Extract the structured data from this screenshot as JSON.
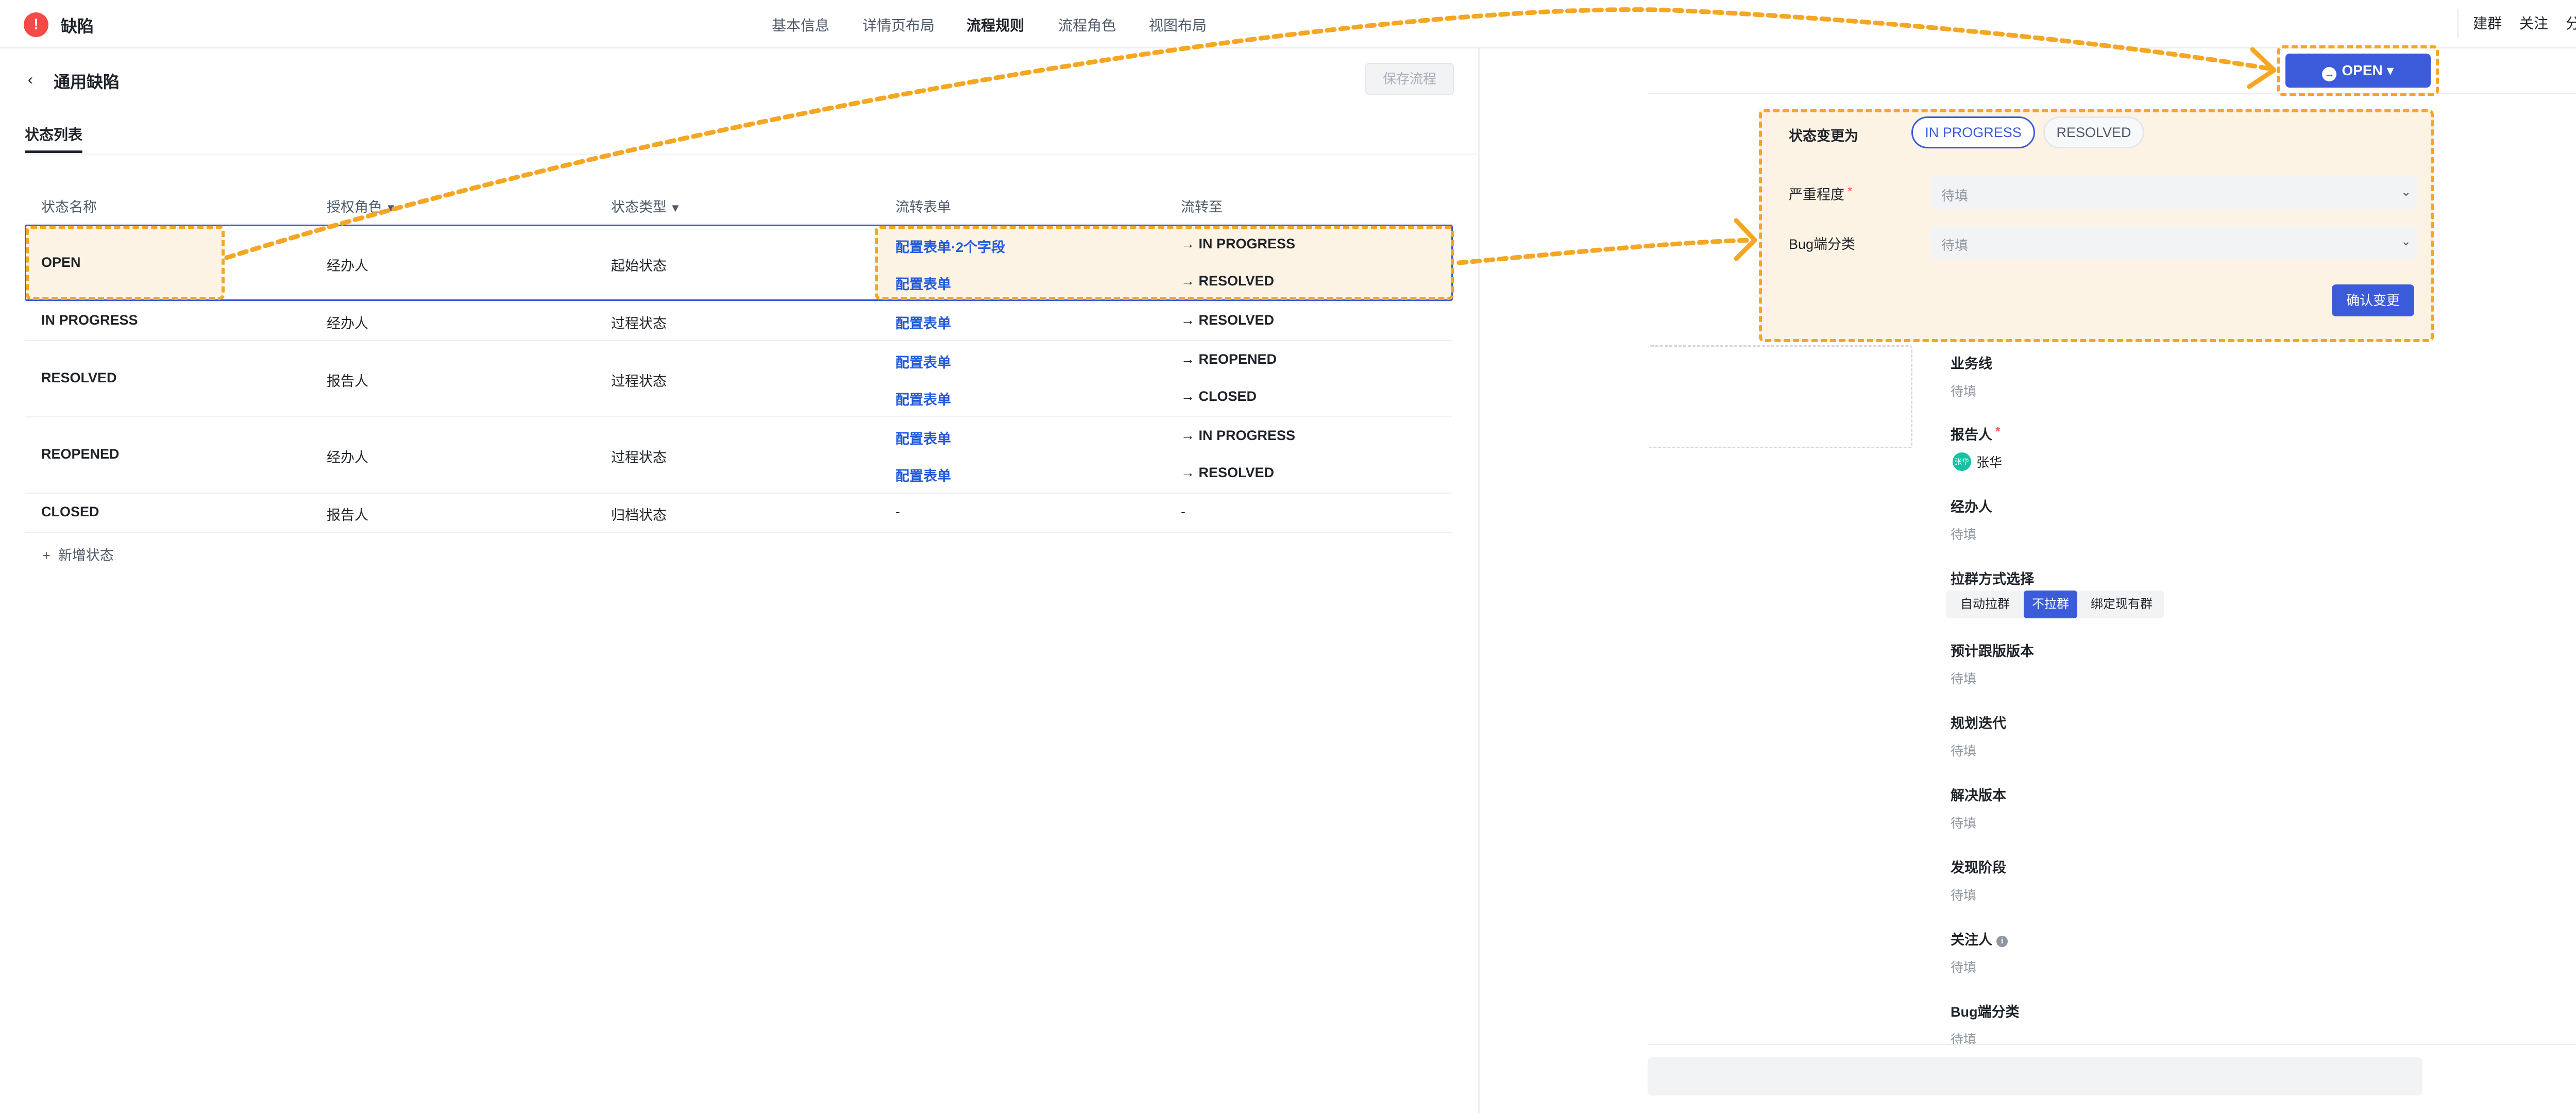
{
  "app": {
    "icon": "!",
    "title": "缺陷"
  },
  "nav_tabs": [
    "基本信息",
    "详情页布局",
    "流程规则",
    "流程角色",
    "视图布局"
  ],
  "top_actions": {
    "create_group": "建群",
    "follow": "关注",
    "share": "分享",
    "more": "···",
    "close": "✕"
  },
  "workflow": {
    "back_icon": "chevron-left-icon",
    "title": "通用缺陷",
    "save_label": "保存流程",
    "subtab": "状态列表",
    "columns": [
      "状态名称",
      "授权角色",
      "状态类型",
      "流转表单",
      "流转至"
    ],
    "rows": [
      {
        "name": "OPEN",
        "role": "经办人",
        "type": "起始状态",
        "transitions": [
          {
            "form": "配置表单·2个字段",
            "to": "IN PROGRESS"
          },
          {
            "form": "配置表单",
            "to": "RESOLVED"
          }
        ]
      },
      {
        "name": "IN PROGRESS",
        "role": "经办人",
        "type": "过程状态",
        "transitions": [
          {
            "form": "配置表单",
            "to": "RESOLVED"
          }
        ]
      },
      {
        "name": "RESOLVED",
        "role": "报告人",
        "type": "过程状态",
        "transitions": [
          {
            "form": "配置表单",
            "to": "REOPENED"
          },
          {
            "form": "配置表单",
            "to": "CLOSED"
          }
        ]
      },
      {
        "name": "REOPENED",
        "role": "经办人",
        "type": "过程状态",
        "transitions": [
          {
            "form": "配置表单",
            "to": "IN PROGRESS"
          },
          {
            "form": "配置表单",
            "to": "RESOLVED"
          }
        ]
      },
      {
        "name": "CLOSED",
        "role": "报告人",
        "type": "归档状态",
        "transitions": [
          {
            "form": "-",
            "to": "-"
          }
        ]
      }
    ],
    "add_status": "新增状态"
  },
  "preview": {
    "status_button": "OPEN",
    "popover": {
      "change_label": "状态变更为",
      "options": [
        "IN PROGRESS",
        "RESOLVED"
      ],
      "selected": "IN PROGRESS",
      "fields": [
        {
          "label": "严重程度",
          "required": true,
          "placeholder": "待填"
        },
        {
          "label": "Bug端分类",
          "required": false,
          "placeholder": "待填"
        }
      ],
      "confirm": "确认变更"
    },
    "fields": [
      {
        "label": "业务线",
        "value": "待填"
      },
      {
        "label": "报告人",
        "required": true,
        "user": "张华",
        "avatar": "张华"
      },
      {
        "label": "经办人",
        "value": "待填"
      },
      {
        "label": "拉群方式选择",
        "options": [
          "自动拉群",
          "不拉群",
          "绑定现有群"
        ],
        "selected": "不拉群"
      },
      {
        "label": "预计跟版版本",
        "value": "待填"
      },
      {
        "label": "规划迭代",
        "value": "待填"
      },
      {
        "label": "解决版本",
        "value": "待填"
      },
      {
        "label": "发现阶段",
        "value": "待填"
      },
      {
        "label": "关注人",
        "value": "待填",
        "info_icon": "info-icon"
      },
      {
        "label": "Bug端分类",
        "value": "待填"
      }
    ]
  },
  "colors": {
    "accent": "#3b5bdb",
    "link": "#245bdb",
    "highlight": "#f5a623",
    "highlight_fill": "#fdf3e4",
    "danger": "#f54a45"
  }
}
